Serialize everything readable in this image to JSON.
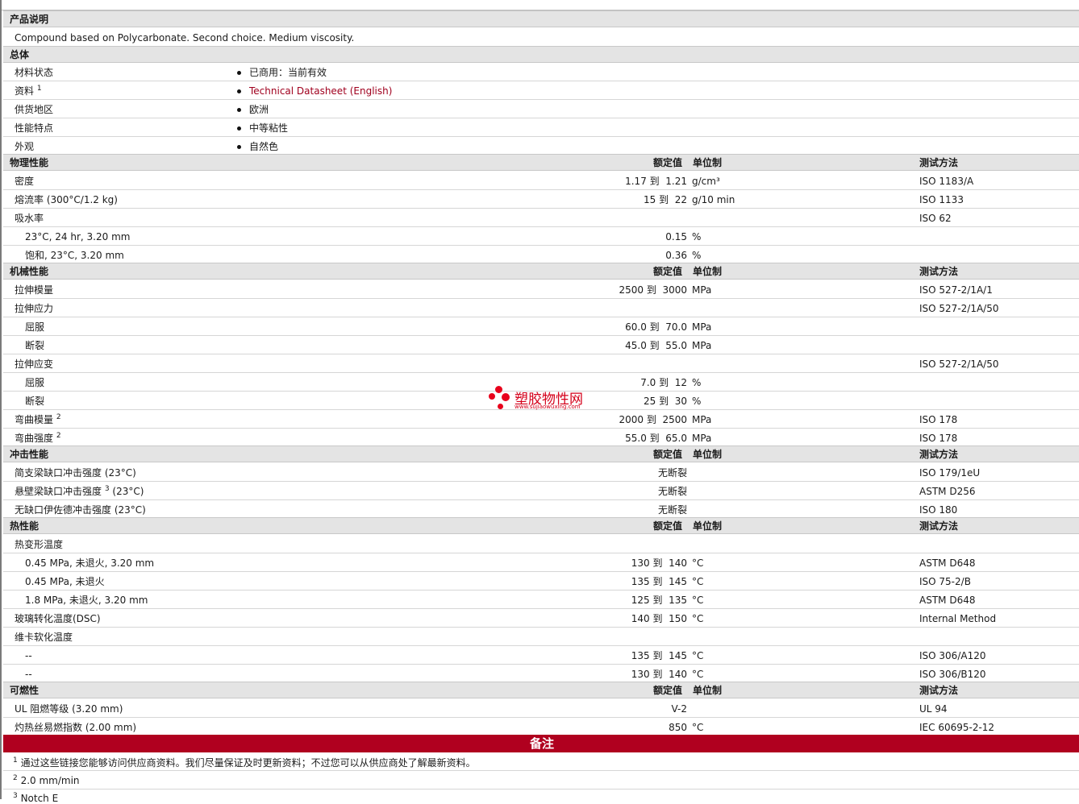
{
  "sections": {
    "desc_title": "产品说明",
    "desc_text": "Compound based on Polycarbonate. Second choice. Medium viscosity.",
    "general_title": "总体",
    "physical_title": "物理性能",
    "mechanical_title": "机械性能",
    "impact_title": "冲击性能",
    "thermal_title": "热性能",
    "flammability_title": "可燃性"
  },
  "headers": {
    "nominal": "额定值",
    "unit": "单位制",
    "method": "测试方法"
  },
  "general": {
    "status_label": "材料状态",
    "status_value": "已商用：当前有效",
    "docs_label": "资料",
    "docs_sup": "1",
    "docs_value": "Technical Datasheet (English)",
    "region_label": "供货地区",
    "region_value": "欧洲",
    "feature_label": "性能特点",
    "feature_value": "中等粘性",
    "appearance_label": "外观",
    "appearance_value": "自然色"
  },
  "physical": [
    {
      "label": "密度",
      "nom": "1.17 到  1.21",
      "unit": "g/cm³",
      "method": "ISO 1183/A"
    },
    {
      "label": "熔流率  (300°C/1.2 kg)",
      "nom": "15 到  22",
      "unit": "g/10 min",
      "method": "ISO 1133"
    },
    {
      "label": "吸水率",
      "nom": "",
      "unit": "",
      "method": "ISO 62"
    },
    {
      "label": "23°C, 24 hr, 3.20 mm",
      "nom": "0.15",
      "unit": "%",
      "method": ""
    },
    {
      "label": "饱和, 23°C, 3.20 mm",
      "nom": "0.36",
      "unit": "%",
      "method": ""
    }
  ],
  "mechanical": [
    {
      "label": "拉伸模量",
      "nom": "2500 到  3000",
      "unit": "MPa",
      "method": "ISO 527-2/1A/1"
    },
    {
      "label": "拉伸应力",
      "nom": "",
      "unit": "",
      "method": "ISO 527-2/1A/50"
    },
    {
      "label": "屈服",
      "nom": "60.0 到  70.0",
      "unit": "MPa",
      "method": ""
    },
    {
      "label": "断裂",
      "nom": "45.0 到  55.0",
      "unit": "MPa",
      "method": ""
    },
    {
      "label": "拉伸应变",
      "nom": "",
      "unit": "",
      "method": "ISO 527-2/1A/50"
    },
    {
      "label": "屈服",
      "nom": "7.0 到  12",
      "unit": "%",
      "method": ""
    },
    {
      "label": "断裂",
      "nom": "25 到  30",
      "unit": "%",
      "method": ""
    },
    {
      "label": "弯曲模量",
      "sup": "2",
      "nom": "2000 到  2500",
      "unit": "MPa",
      "method": "ISO 178"
    },
    {
      "label": "弯曲强度",
      "sup": "2",
      "nom": "55.0 到  65.0",
      "unit": "MPa",
      "method": "ISO 178"
    }
  ],
  "impact": [
    {
      "label": "简支梁缺口冲击强度  (23°C)",
      "nom": "无断裂",
      "unit": "",
      "method": "ISO 179/1eU"
    },
    {
      "label": "悬壁梁缺口冲击强度",
      "sup": "3",
      "label2": " (23°C)",
      "nom": "无断裂",
      "unit": "",
      "method": "ASTM D256"
    },
    {
      "label": "无缺口伊佐德冲击强度  (23°C)",
      "nom": "无断裂",
      "unit": "",
      "method": "ISO 180"
    }
  ],
  "thermal": [
    {
      "label": "热变形温度",
      "nom": "",
      "unit": "",
      "method": ""
    },
    {
      "label": "0.45 MPa, 未退火, 3.20 mm",
      "nom": "130 到  140",
      "unit": "°C",
      "method": "ASTM D648"
    },
    {
      "label": "0.45 MPa, 未退火",
      "nom": "135 到  145",
      "unit": "°C",
      "method": "ISO 75-2/B"
    },
    {
      "label": "1.8 MPa, 未退火, 3.20 mm",
      "nom": "125 到  135",
      "unit": "°C",
      "method": "ASTM D648"
    },
    {
      "label": "玻璃转化温度(DSC)",
      "nom": "140 到  150",
      "unit": "°C",
      "method": "Internal Method"
    },
    {
      "label": "维卡软化温度",
      "nom": "",
      "unit": "",
      "method": ""
    },
    {
      "label": "--",
      "nom": "135 到  145",
      "unit": "°C",
      "method": "ISO 306/A120"
    },
    {
      "label": "--",
      "nom": "130 到  140",
      "unit": "°C",
      "method": "ISO 306/B120"
    }
  ],
  "flammability": [
    {
      "label": "UL 阻燃等级  (3.20 mm)",
      "nom": "V-2",
      "unit": "",
      "method": "UL 94"
    },
    {
      "label": "灼热丝易燃指数  (2.00 mm)",
      "nom": "850",
      "unit": "°C",
      "method": "IEC 60695-2-12"
    }
  ],
  "notes": {
    "title": "备注",
    "n1_sup": "1",
    "n1": "通过这些链接您能够访问供应商资料。我们尽量保证及时更新资料；不过您可以从供应商处了解最新资料。",
    "n2_sup": "2",
    "n2": "2.0 mm/min",
    "n3_sup": "3",
    "n3": "Notch E"
  },
  "watermark": {
    "name": "塑胶物性网",
    "url": "www.sujiaowuxing.com"
  }
}
